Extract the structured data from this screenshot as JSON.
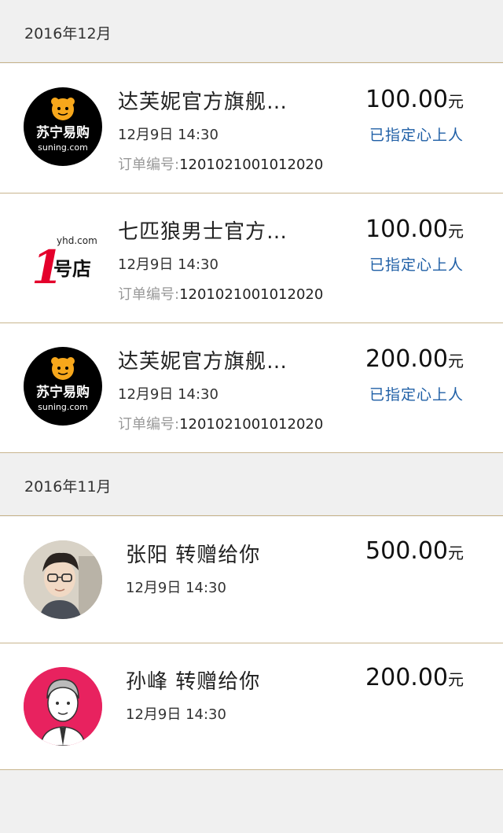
{
  "sections": [
    {
      "month": "2016年12月",
      "items": [
        {
          "logo": "suning-logo",
          "logo_lines": [
            "苏宁易购",
            "suning.com"
          ],
          "title": "达芙妮官方旗舰…",
          "time": "12月9日 14:30",
          "order_label": "订单编号:",
          "order_no": "1201021001012020",
          "amount": "100.00",
          "unit": "元",
          "status": "已指定心上人"
        },
        {
          "logo": "yhd-logo",
          "logo_lines": [
            "1",
            "yhd.com",
            "号店"
          ],
          "title": "七匹狼男士官方…",
          "time": "12月9日 14:30",
          "order_label": "订单编号:",
          "order_no": "1201021001012020",
          "amount": "100.00",
          "unit": "元",
          "status": "已指定心上人"
        },
        {
          "logo": "suning-logo",
          "logo_lines": [
            "苏宁易购",
            "suning.com"
          ],
          "title": "达芙妮官方旗舰…",
          "time": "12月9日 14:30",
          "order_label": "订单编号:",
          "order_no": "1201021001012020",
          "amount": "200.00",
          "unit": "元",
          "status": "已指定心上人"
        }
      ]
    },
    {
      "month": "2016年11月",
      "items": [
        {
          "logo": "user-photo-avatar",
          "title": "张阳  转赠给你",
          "time": "12月9日 14:30",
          "amount": "500.00",
          "unit": "元"
        },
        {
          "logo": "cartoon-man-avatar",
          "title": "孙峰  转赠给你",
          "time": "12月9日 14:30",
          "amount": "200.00",
          "unit": "元"
        }
      ]
    }
  ],
  "colors": {
    "accent_blue": "#1f5fa6",
    "divider_gold": "#c8b58e",
    "suning_orange": "#f7a71b",
    "yhd_red": "#e4002b",
    "avatar_pink": "#e8225f"
  }
}
